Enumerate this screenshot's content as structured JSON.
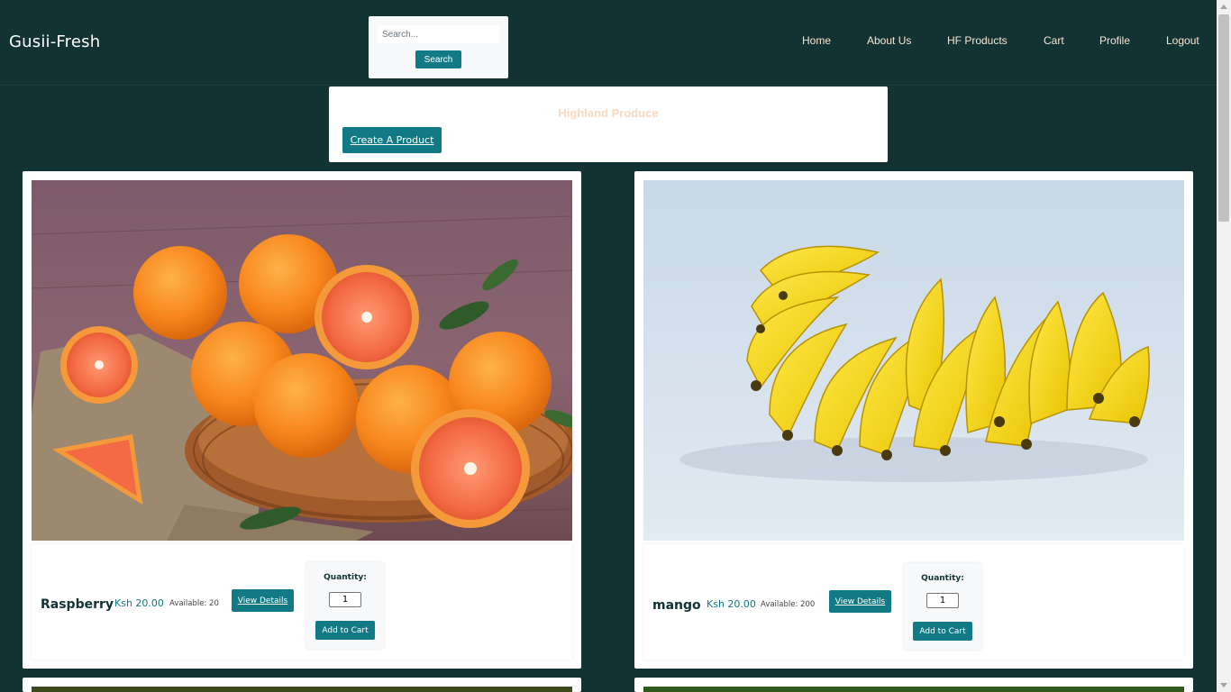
{
  "header": {
    "brand": "Gusii-Fresh",
    "search": {
      "placeholder": "Search...",
      "value": "",
      "button_label": "Search"
    },
    "nav": [
      "Home",
      "About Us",
      "HF Products",
      "Cart",
      "Profile",
      "Logout"
    ]
  },
  "section": {
    "title": "Highland Produce",
    "create_button": "Create A Product"
  },
  "products": [
    {
      "name": "Raspberry",
      "price": "Ksh 20.00",
      "available": "Available: 20",
      "details_button": "View Details",
      "quantity_label": "Quantity:",
      "quantity_value": "1",
      "cart_button": "Add to Cart",
      "image": "oranges-in-basket-photo"
    },
    {
      "name": "mango",
      "price": "Ksh 20.00",
      "available": "Available: 200",
      "details_button": "View Details",
      "quantity_label": "Quantity:",
      "quantity_value": "1",
      "cart_button": "Add to Cart",
      "image": "bananas-bunch-photo"
    }
  ],
  "colors": {
    "background": "#133233",
    "accent": "#117a84",
    "nav_text": "#f7e6d3",
    "section_title": "#f8d9c2"
  }
}
